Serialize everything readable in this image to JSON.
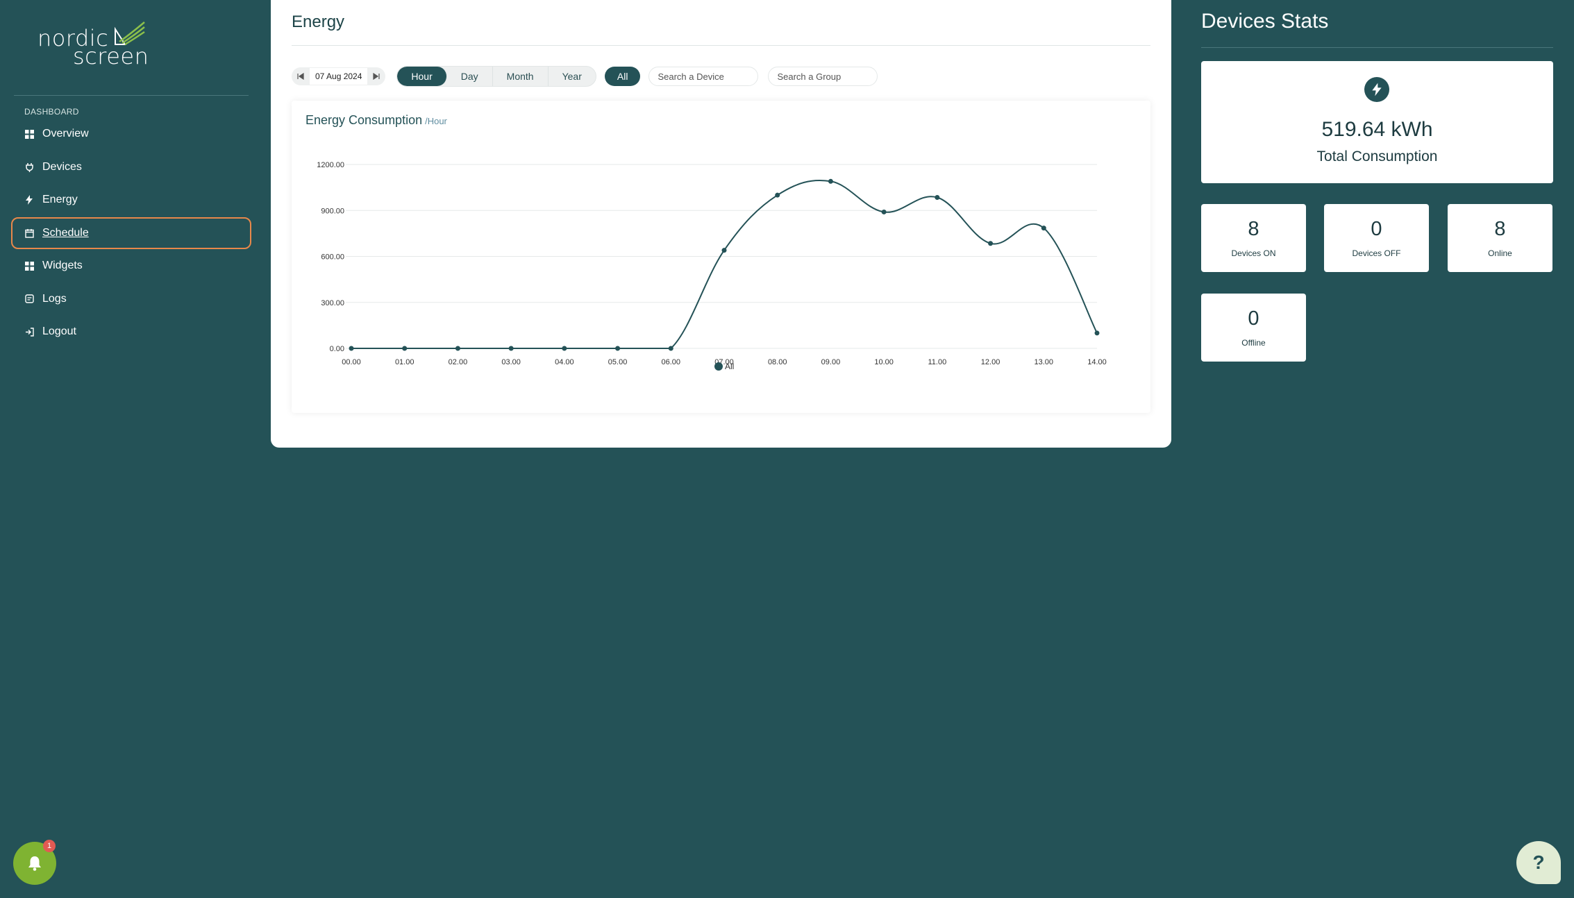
{
  "brand": {
    "line1": "nordic",
    "line2": "screen"
  },
  "sidebar": {
    "section_label": "DASHBOARD",
    "items": [
      {
        "label": "Overview",
        "icon": "grid-icon"
      },
      {
        "label": "Devices",
        "icon": "plug-icon"
      },
      {
        "label": "Energy",
        "icon": "bolt-icon"
      },
      {
        "label": "Schedule",
        "icon": "calendar-icon",
        "active": true
      },
      {
        "label": "Widgets",
        "icon": "grid-icon"
      },
      {
        "label": "Logs",
        "icon": "log-icon"
      },
      {
        "label": "Logout",
        "icon": "logout-icon"
      }
    ]
  },
  "energy": {
    "title": "Energy",
    "date": "07 Aug 2024",
    "periods": [
      "Hour",
      "Day",
      "Month",
      "Year"
    ],
    "selected_period": "Hour",
    "all_label": "All",
    "search_device_placeholder": "Search a Device",
    "search_group_placeholder": "Search a Group",
    "chart_title": "Energy Consumption",
    "chart_unit": "/Hour"
  },
  "chart_data": {
    "type": "line",
    "title": "Energy Consumption",
    "subtitle": "/Hour",
    "x": [
      "00.00",
      "01.00",
      "02.00",
      "03.00",
      "04.00",
      "05.00",
      "06.00",
      "07.00",
      "08.00",
      "09.00",
      "10.00",
      "11.00",
      "12.00",
      "13.00",
      "14.00"
    ],
    "series": [
      {
        "name": "All",
        "values": [
          0,
          0,
          0,
          0,
          0,
          0,
          0,
          640,
          1000,
          1090,
          890,
          985,
          685,
          785,
          100
        ],
        "color": "#245257"
      }
    ],
    "yticks": [
      "0.00",
      "300.00",
      "600.00",
      "900.00",
      "1200.00"
    ],
    "ylim": [
      0,
      1200
    ],
    "grid": true,
    "legend": "bottom-center",
    "xlabel": "",
    "ylabel": ""
  },
  "stats": {
    "title": "Devices Stats",
    "total_value": "519.64 kWh",
    "total_label": "Total Consumption",
    "cards": [
      {
        "value": "8",
        "label": "Devices ON"
      },
      {
        "value": "0",
        "label": "Devices OFF"
      },
      {
        "value": "8",
        "label": "Online"
      },
      {
        "value": "0",
        "label": "Offline"
      }
    ]
  },
  "notifications": {
    "count": "1"
  },
  "help": {
    "label": "?"
  },
  "colors": {
    "background": "#245257",
    "accent": "#245257",
    "active_outline": "#e8884a",
    "bell": "#7fb332",
    "badge": "#e25a53"
  }
}
